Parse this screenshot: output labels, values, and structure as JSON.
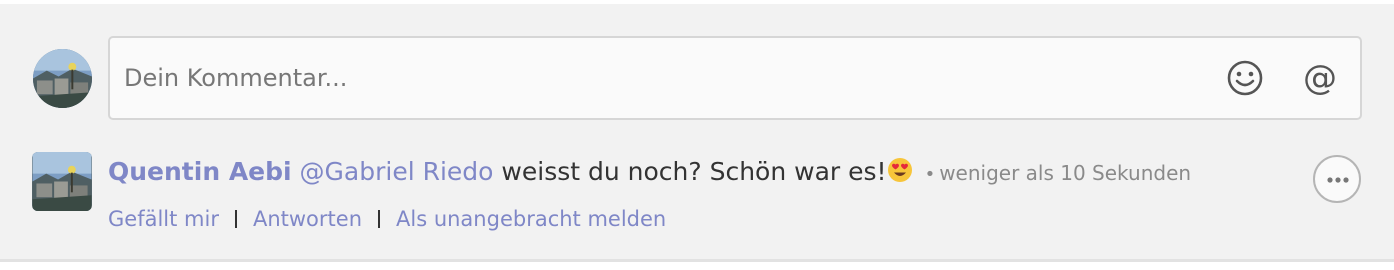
{
  "composer": {
    "placeholder": "Dein Kommentar...",
    "value": "",
    "current_user_avatar": "user-avatar-photo",
    "emoji_icon": "smiley-face-icon",
    "mention_icon": "at-sign-icon",
    "mention_glyph": "@"
  },
  "comment": {
    "author": "Quentin Aebi",
    "mention": "@Gabriel Riedo",
    "text": " weisst du noch? Schön war es!",
    "emoji": "heart-eyes-emoji",
    "separator": "•",
    "timestamp": "weniger als 10 Sekunden",
    "author_avatar": "author-avatar-photo",
    "more_icon": "more-options-icon",
    "actions": {
      "like": "Gefällt mir",
      "reply": "Antworten",
      "report": "Als unangebracht melden"
    }
  },
  "colors": {
    "accent": "#7f87c7",
    "panel_background": "#f2f2f2",
    "input_border": "#d6d6d6",
    "text": "#333333",
    "muted": "#8a8a8a"
  }
}
